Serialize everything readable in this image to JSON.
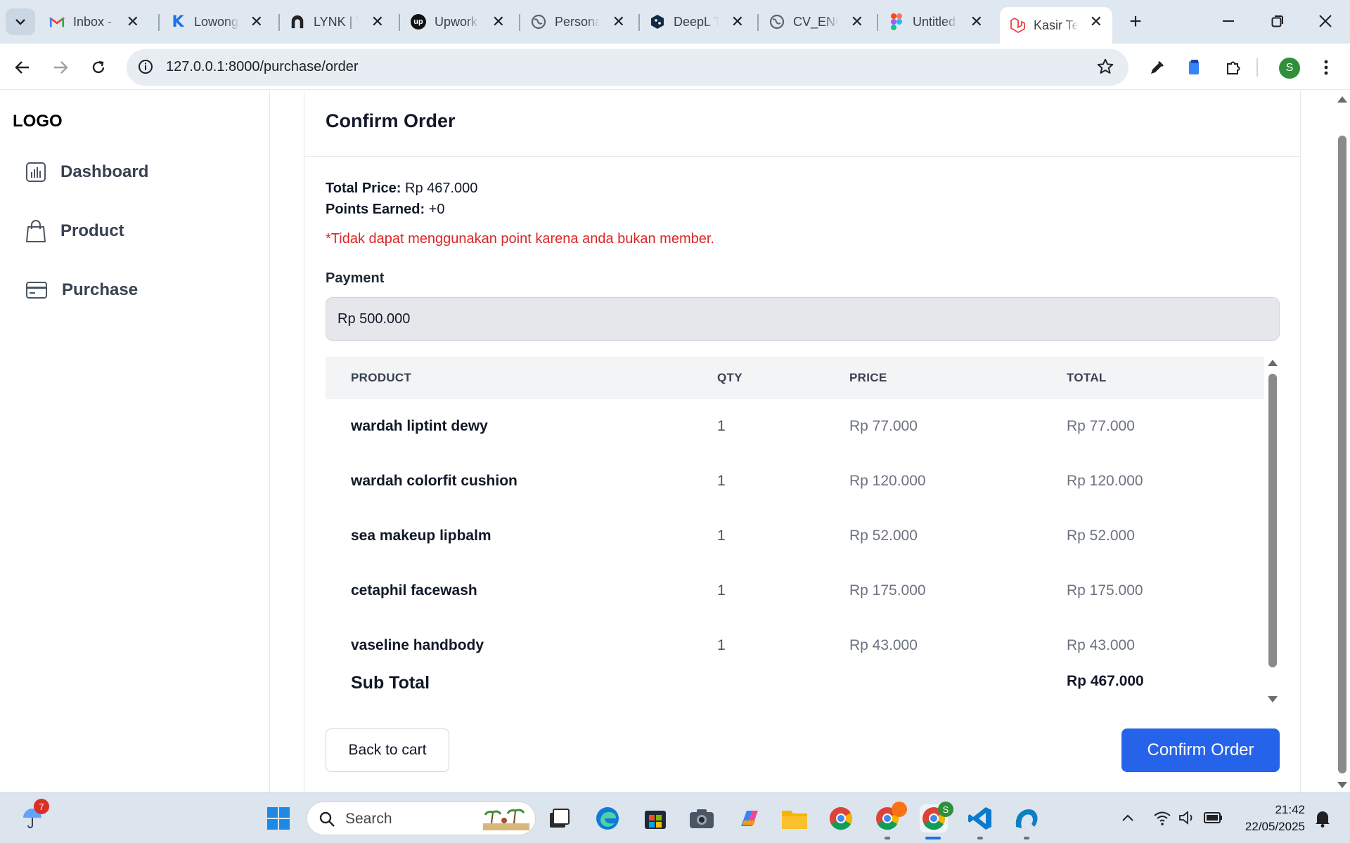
{
  "browser": {
    "tabs": [
      {
        "title": "Inbox - ",
        "icon": "gmail-icon"
      },
      {
        "title": "Lowong",
        "icon": "k-icon"
      },
      {
        "title": "LYNK | V",
        "icon": "lynk-icon"
      },
      {
        "title": "Upwork",
        "icon": "upwork-icon"
      },
      {
        "title": "Persona",
        "icon": "globe-icon"
      },
      {
        "title": "DeepL T",
        "icon": "deepl-icon"
      },
      {
        "title": "CV_ENG",
        "icon": "globe-icon"
      },
      {
        "title": "Untitled",
        "icon": "figma-icon"
      },
      {
        "title": "Kasir Te",
        "icon": "laravel-icon"
      }
    ],
    "active_tab_index": 8,
    "url": "127.0.0.1:8000/purchase/order",
    "profile_initial": "S"
  },
  "sidebar": {
    "logo": "LOGO",
    "items": [
      {
        "label": "Dashboard",
        "icon": "chart-icon"
      },
      {
        "label": "Product",
        "icon": "shopping-bag-icon"
      },
      {
        "label": "Purchase",
        "icon": "credit-card-icon"
      }
    ]
  },
  "order": {
    "title": "Confirm Order",
    "total_price_label": "Total Price:",
    "total_price_value": "Rp 467.000",
    "points_label": "Points Earned:",
    "points_value": "+0",
    "warning": "*Tidak dapat menggunakan point karena anda bukan member.",
    "payment_label": "Payment",
    "payment_value": "Rp 500.000",
    "table": {
      "headers": [
        "PRODUCT",
        "QTY",
        "PRICE",
        "TOTAL"
      ],
      "rows": [
        {
          "product": "wardah liptint dewy",
          "qty": "1",
          "price": "Rp 77.000",
          "total": "Rp 77.000"
        },
        {
          "product": "wardah colorfit cushion",
          "qty": "1",
          "price": "Rp 120.000",
          "total": "Rp 120.000"
        },
        {
          "product": "sea makeup lipbalm",
          "qty": "1",
          "price": "Rp 52.000",
          "total": "Rp 52.000"
        },
        {
          "product": "cetaphil facewash",
          "qty": "1",
          "price": "Rp 175.000",
          "total": "Rp 175.000"
        },
        {
          "product": "vaseline handbody",
          "qty": "1",
          "price": "Rp 43.000",
          "total": "Rp 43.000"
        }
      ],
      "subtotal_label": "Sub Total",
      "subtotal_value": "Rp 467.000"
    },
    "back_button": "Back to cart",
    "confirm_button": "Confirm Order"
  },
  "taskbar": {
    "search_label": "Search",
    "weather_badge": "7",
    "chrome_badge": "S",
    "time": "21:42",
    "date": "22/05/2025"
  },
  "colors": {
    "accent": "#2563eb",
    "warning": "#dc2626"
  }
}
